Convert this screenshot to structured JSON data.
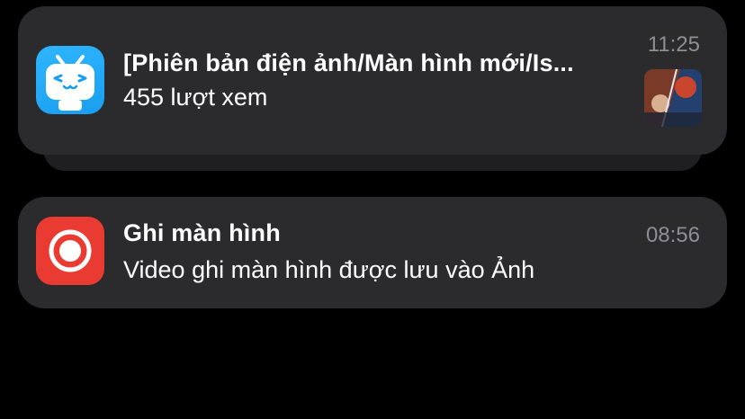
{
  "notifications": [
    {
      "app_icon": "bilibili-tv-icon",
      "title": "[Phiên bản điện ảnh/Màn hình mới/Is...",
      "body": "455 lượt xem",
      "time": "11:25",
      "has_thumbnail": true,
      "accent": "#1a9ef0"
    },
    {
      "app_icon": "screen-record-icon",
      "title": "Ghi màn hình",
      "body": "Video ghi màn hình được lưu vào Ảnh",
      "time": "08:56",
      "has_thumbnail": false,
      "accent": "#ea3b32"
    }
  ],
  "colors": {
    "background": "#000000",
    "card": "#2b2b2e",
    "time_text": "#8e8e93"
  }
}
